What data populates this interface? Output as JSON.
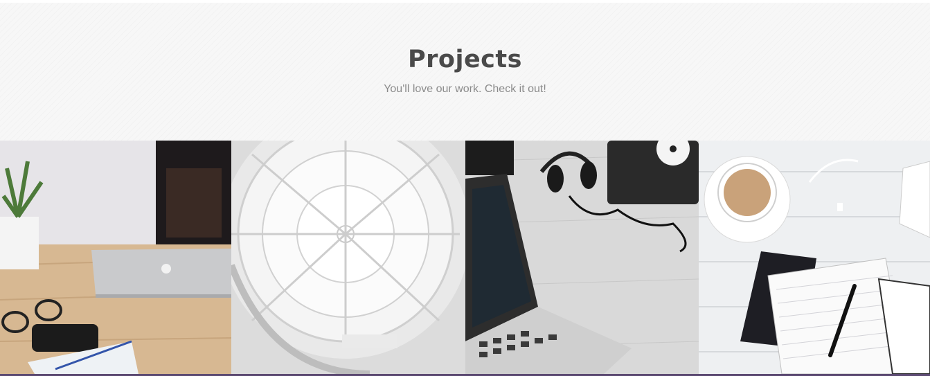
{
  "section": {
    "title": "Projects",
    "subtitle": "You'll love our work. Check it out!"
  },
  "projects": [
    {
      "image": "desk-laptop-plant-glasses"
    },
    {
      "image": "dome-skylight-architecture"
    },
    {
      "image": "laptop-headphones-turntable"
    },
    {
      "image": "coffee-notebook-pen"
    }
  ],
  "colors": {
    "title": "#4a4a4a",
    "subtitle": "#8a8a8a",
    "header_bg": "#f7f7f7",
    "accent_bar": "#5c4a72"
  }
}
